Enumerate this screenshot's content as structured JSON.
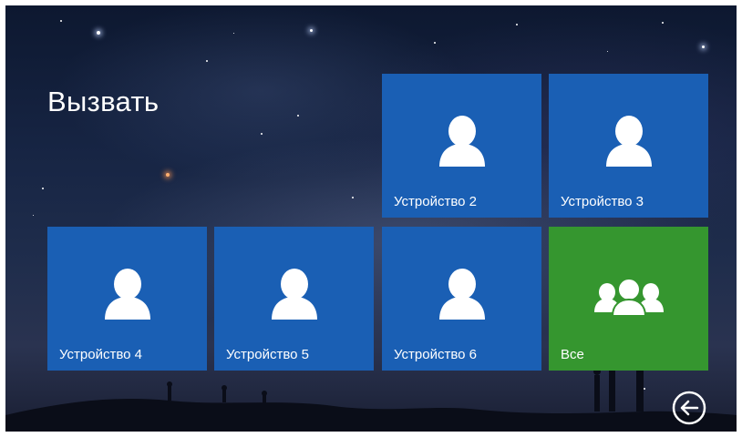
{
  "page": {
    "title": "Вызвать"
  },
  "tiles": [
    {
      "label": "Устройство 2",
      "icon": "person-icon",
      "color": "#1a5fb4"
    },
    {
      "label": "Устройство 3",
      "icon": "person-icon",
      "color": "#1a5fb4"
    },
    {
      "label": "Устройство 4",
      "icon": "person-icon",
      "color": "#1a5fb4"
    },
    {
      "label": "Устройство 5",
      "icon": "person-icon",
      "color": "#1a5fb4"
    },
    {
      "label": "Устройство 6",
      "icon": "person-icon",
      "color": "#1a5fb4"
    },
    {
      "label": "Все",
      "icon": "group-icon",
      "color": "#35962f"
    }
  ],
  "navigation": {
    "back_icon": "back-arrow-icon"
  }
}
